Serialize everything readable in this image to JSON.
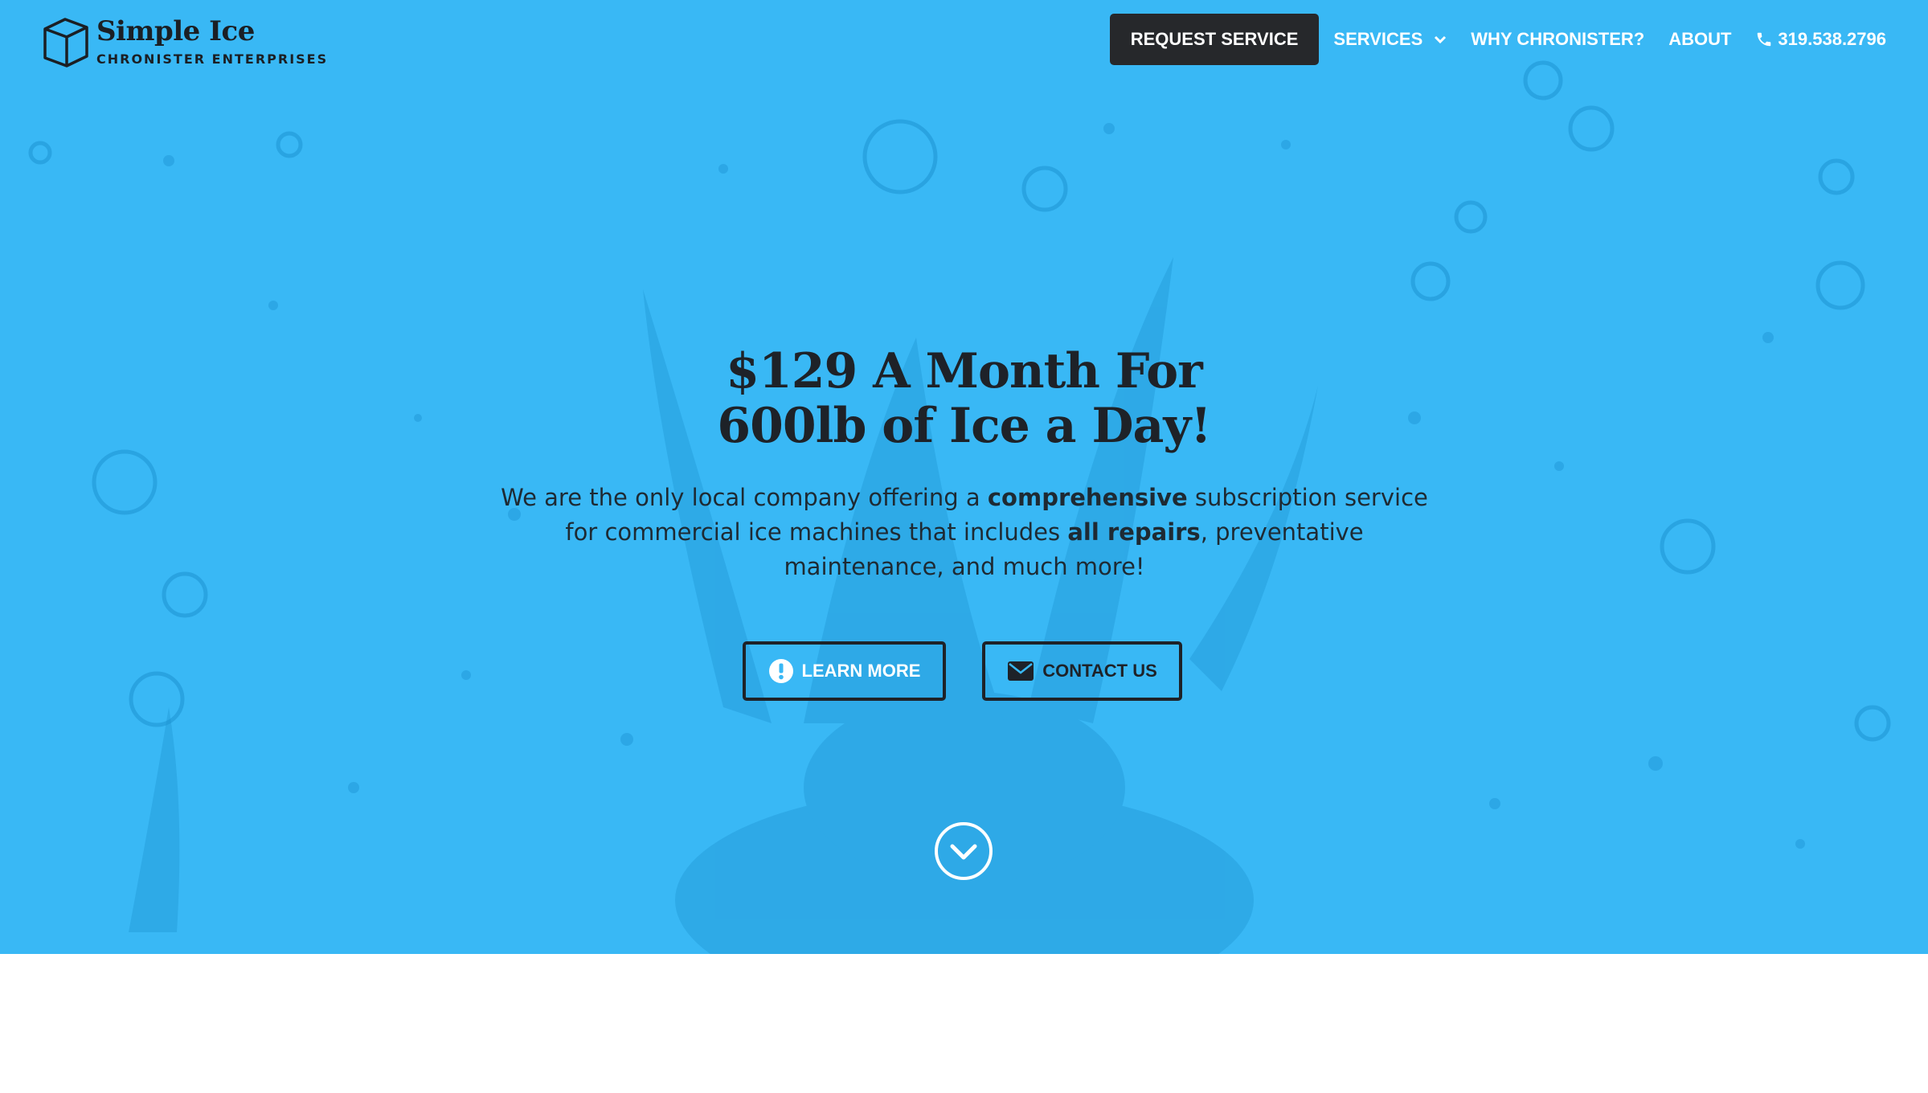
{
  "brand": {
    "title": "Simple Ice",
    "subtitle": "CHRONISTER ENTERPRISES",
    "logo_icon": "ice-cube-icon"
  },
  "nav": {
    "request_label": "REQUEST SERVICE",
    "services_label": "SERVICES",
    "why_label": "WHY CHRONISTER?",
    "about_label": "ABOUT",
    "phone": "319.538.2796"
  },
  "hero": {
    "headline_line1": "$129 A Month For",
    "headline_line2": "600lb of Ice a Day!",
    "para_1": "We are the only local company offering a ",
    "para_bold_1": "comprehensive",
    "para_2": " subscription service for commercial ice machines that includes ",
    "para_bold_2": "all repairs",
    "para_3": ", preventative maintenance, and much more!",
    "learn_more_label": "LEARN MORE",
    "contact_label": "CONTACT US"
  },
  "colors": {
    "hero_background": "#39b8f5",
    "dark": "#26282b",
    "text": "#1e2228"
  }
}
